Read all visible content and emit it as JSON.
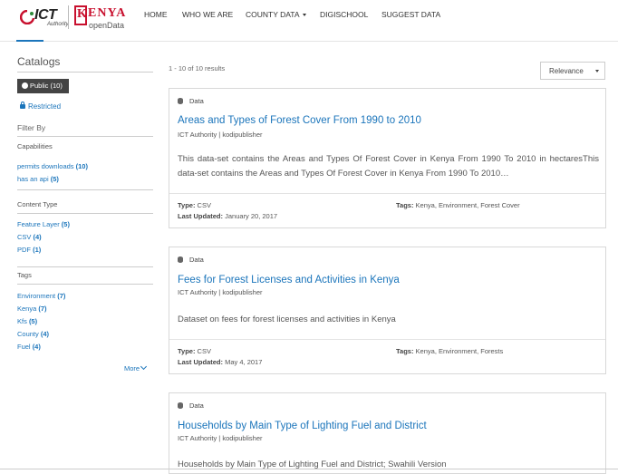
{
  "header": {
    "logo_ict": "ICT",
    "logo_authority": "Authority",
    "logo_kenya_k": "K",
    "logo_kenya": "ENYA",
    "logo_opendata": "openData",
    "nav": [
      "HOME",
      "WHO WE ARE",
      "COUNTY DATA",
      "DIGISCHOOL",
      "SUGGEST DATA"
    ],
    "accent_color": "#1b75bb"
  },
  "sidebar": {
    "title": "Catalogs",
    "public_pill": "Public (10)",
    "restricted": "Restricted",
    "filter_by": "Filter By",
    "sections": [
      {
        "title": "Capabilities",
        "items": [
          {
            "label": "permits downloads",
            "count": "(10)"
          },
          {
            "label": "has an api",
            "count": "(5)"
          }
        ]
      },
      {
        "title": "Content Type",
        "items": [
          {
            "label": "Feature Layer",
            "count": "(5)"
          },
          {
            "label": "CSV",
            "count": "(4)"
          },
          {
            "label": "PDF",
            "count": "(1)"
          }
        ]
      },
      {
        "title": "Tags",
        "items": [
          {
            "label": "Environment",
            "count": "(7)"
          },
          {
            "label": "Kenya",
            "count": "(7)"
          },
          {
            "label": "Kfs",
            "count": "(5)"
          },
          {
            "label": "County",
            "count": "(4)"
          },
          {
            "label": "Fuel",
            "count": "(4)"
          }
        ]
      }
    ],
    "more": "More"
  },
  "main": {
    "results_count": "1 - 10 of 10 results",
    "sort": "Relevance",
    "cards": [
      {
        "type": "Data",
        "title": "Areas and Types of Forest Cover From 1990 to 2010",
        "publisher": "ICT Authority | kodipublisher",
        "description": "This data-set contains the Areas and Types Of Forest Cover in Kenya From 1990 To 2010 in hectaresThis data-set contains the Areas and Types Of Forest Cover in Kenya From 1990 To 2010…",
        "type_label": "Type:",
        "type_value": "CSV",
        "updated_label": "Last Updated:",
        "updated_value": "January 20, 2017",
        "tags_label": "Tags:",
        "tags_value": "Kenya, Environment, Forest Cover"
      },
      {
        "type": "Data",
        "title": "Fees for Forest Licenses and Activities in Kenya",
        "publisher": "ICT Authority | kodipublisher",
        "description": "Dataset on fees for forest licenses and activities in Kenya",
        "type_label": "Type:",
        "type_value": "CSV",
        "updated_label": "Last Updated:",
        "updated_value": "May 4, 2017",
        "tags_label": "Tags:",
        "tags_value": "Kenya, Environment, Forests"
      },
      {
        "type": "Data",
        "title": "Households by Main Type of Lighting Fuel and District",
        "publisher": "ICT Authority | kodipublisher",
        "description": "Households by Main Type of Lighting Fuel and District; Swahili Version"
      }
    ]
  }
}
